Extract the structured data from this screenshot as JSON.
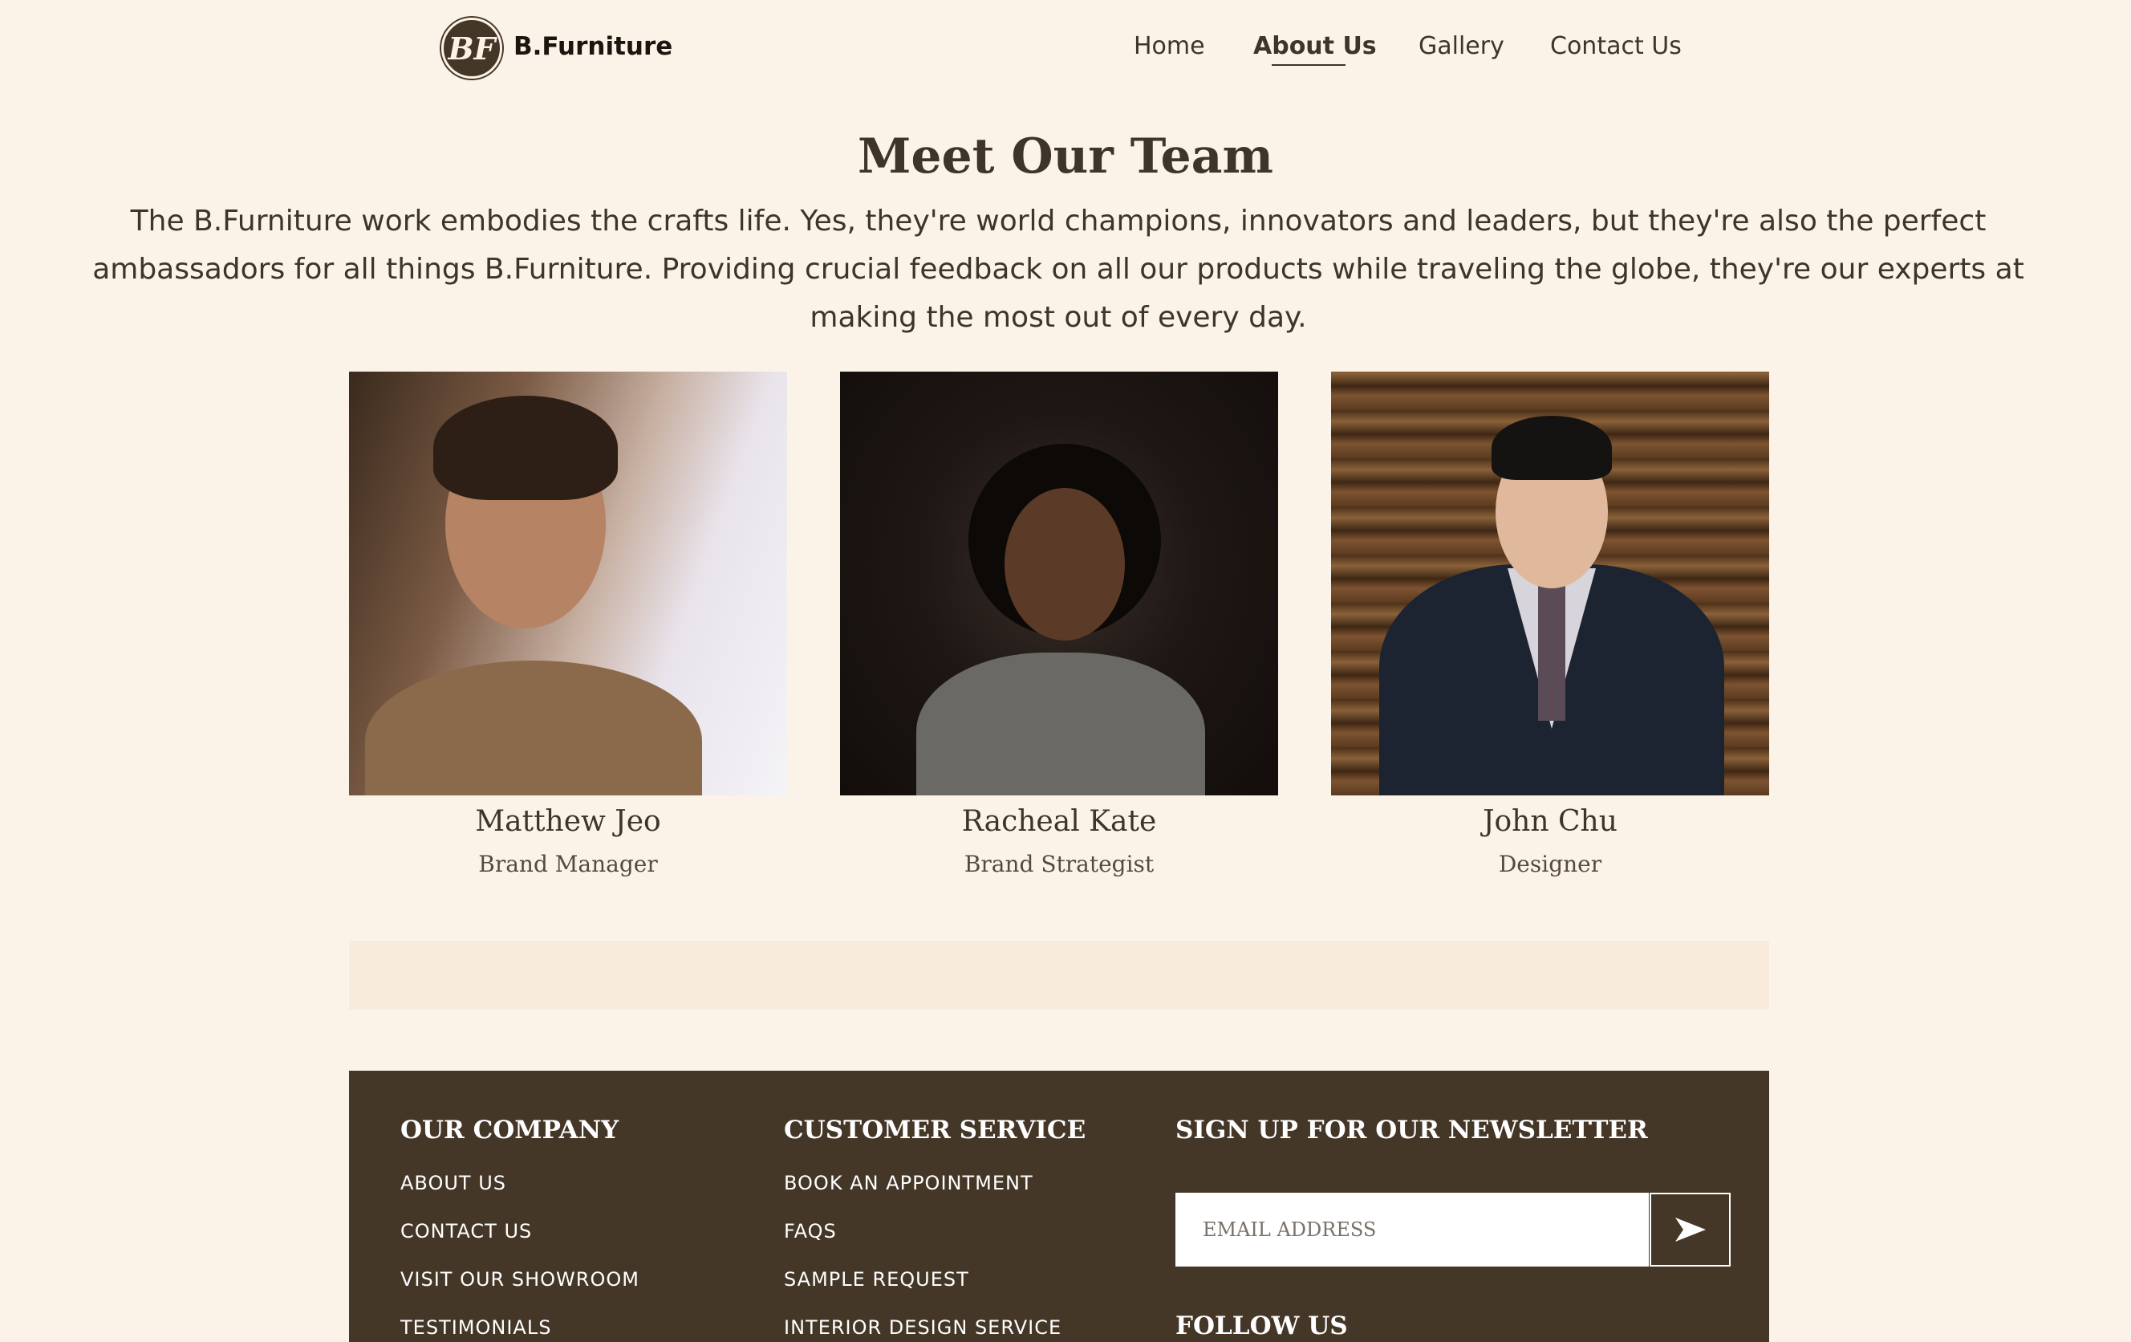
{
  "header": {
    "logo_text": "BF",
    "brand": "B.Furniture",
    "nav": [
      "Home",
      "About Us",
      "Gallery",
      "Contact Us"
    ],
    "active_nav": "About Us"
  },
  "hero": {
    "title": "Meet Our Team",
    "intro": "The B.Furniture work embodies the crafts life. Yes, they're world champions, innovators and leaders, but they're also the perfect ambassadors for all things B.Furniture. Providing crucial feedback on all our products while traveling the globe, they're our experts at making the most out of every day."
  },
  "team": [
    {
      "name": "Matthew Jeo",
      "role": "Brand Manager"
    },
    {
      "name": "Racheal Kate",
      "role": "Brand Strategist"
    },
    {
      "name": "John Chu",
      "role": "Designer"
    }
  ],
  "footer": {
    "company": {
      "heading": "OUR COMPANY",
      "links": [
        "ABOUT US",
        "CONTACT US",
        "VISIT OUR SHOWROOM",
        "TESTIMONIALS"
      ]
    },
    "service": {
      "heading": "CUSTOMER SERVICE",
      "links": [
        "BOOK AN APPOINTMENT",
        "FAQS",
        "SAMPLE REQUEST",
        "INTERIOR DESIGN SERVICE"
      ]
    },
    "newsletter": {
      "heading": "SIGN UP FOR OUR NEWSLETTER",
      "email_placeholder": "EMAIL ADDRESS",
      "follow_heading": "FOLLOW US"
    }
  },
  "colors": {
    "background": "#fcf3e8",
    "text": "#3e3427",
    "footer_bg": "#453727",
    "band": "#f9ebdc"
  }
}
